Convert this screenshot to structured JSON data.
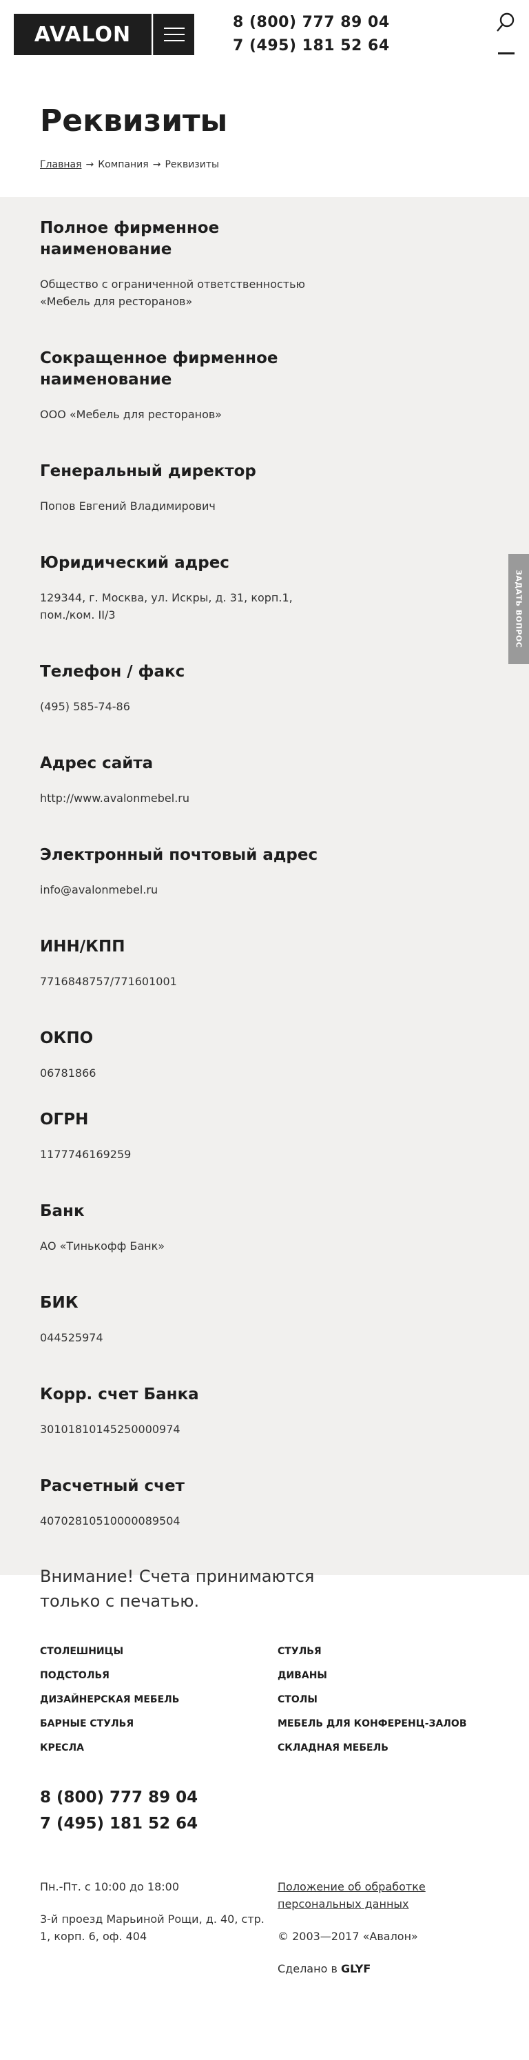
{
  "header": {
    "logo_text": "AVALON",
    "phones": [
      "8 (800) 777 89 04",
      "7 (495) 181 52 64"
    ]
  },
  "page": {
    "title": "Реквизиты",
    "breadcrumb": [
      "Главная",
      "Компания",
      "Реквизиты"
    ]
  },
  "requisites": [
    {
      "label": "Полное фирменное наименование",
      "value": "Общество с ограниченной ответственностью «Мебель для ресторанов»"
    },
    {
      "label": "Сокращенное фирменное наименование",
      "value": "ООО «Мебель для ресторанов»"
    },
    {
      "label": "Генеральный директор",
      "value": "Попов Евгений Владимирович"
    },
    {
      "label": "Юридический адрес",
      "value": "129344, г. Москва, ул. Искры, д. 31, корп.1, пом./ком. II/3"
    },
    {
      "label": "Телефон / факс",
      "value": "(495) 585-74-86"
    },
    {
      "label": "Адрес сайта",
      "value": "http://www.avalonmebel.ru"
    },
    {
      "label": "Электронный почтовый адрес",
      "value": "info@avalonmebel.ru"
    },
    {
      "label": "ИНН/КПП",
      "value": "7716848757/771601001"
    },
    {
      "label": "ОКПО",
      "value": "06781866"
    },
    {
      "label": "ОГРН",
      "value": "1177746169259"
    },
    {
      "label": "Банк",
      "value": "АО «Тинькофф Банк»"
    },
    {
      "label": "БИК",
      "value": "044525974"
    },
    {
      "label": "Корр. счет Банка",
      "value": "30101810145250000974"
    },
    {
      "label": "Расчетный счет",
      "value": "40702810510000089504"
    }
  ],
  "notice": "Внимание! Счета принимаются только с печатью.",
  "side_tab": "ЗАДАТЬ ВОПРОС",
  "footer": {
    "menu": [
      "СТОЛЕШНИЦЫ",
      "СТУЛЬЯ",
      "ПОДСТОЛЬЯ",
      "ДИВАНЫ",
      "ДИЗАЙНЕРСКАЯ МЕБЕЛЬ",
      "СТОЛЫ",
      "БАРНЫЕ СТУЛЬЯ",
      "МЕБЕЛЬ ДЛЯ КОНФЕРЕНЦ-ЗАЛОВ",
      "КРЕСЛА",
      "СКЛАДНАЯ МЕБЕЛЬ"
    ],
    "phones": [
      "8 (800) 777 89 04",
      "7 (495) 181 52 64"
    ],
    "hours": "Пн.-Пт. с 10:00 до 18:00",
    "address": "3-й проезд Марьиной Рощи, д. 40, стр. 1, корп. 6, оф. 404",
    "policy_link": "Положение об обработке персональных данных",
    "copyright": "© 2003—2017 «Авалон»",
    "made_by_prefix": "Сделано в",
    "made_by": "GLYF"
  }
}
